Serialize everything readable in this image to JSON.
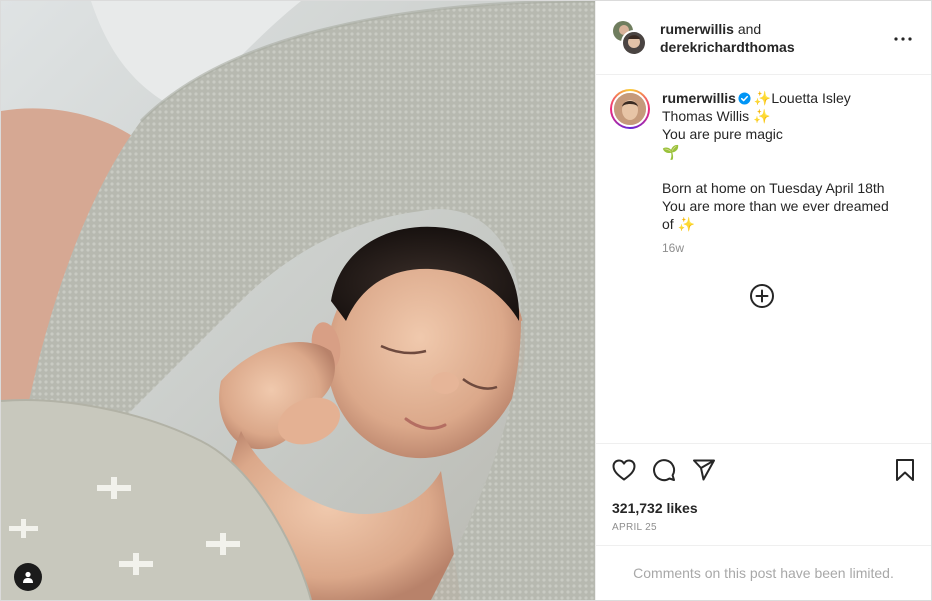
{
  "header": {
    "user1": "rumerwillis",
    "and": "and",
    "user2": "derekrichardthomas"
  },
  "caption": {
    "username": "rumerwillis",
    "lines": [
      "✨Louetta Isley",
      "Thomas Willis ✨",
      "You are pure magic",
      "🌱",
      "",
      "Born at home on Tuesday April 18th",
      "You are more than we ever dreamed",
      "of ✨"
    ],
    "age": "16w"
  },
  "stats": {
    "likes": "321,732 likes",
    "date": "APRIL 25"
  },
  "comments_notice": "Comments on this post have been limited.",
  "icons": {
    "more": "more-horizontal-icon",
    "verified": "verified-badge-icon",
    "plus": "plus-circle-icon",
    "like": "heart-icon",
    "comment": "comment-icon",
    "share": "paper-plane-icon",
    "save": "bookmark-icon",
    "tag": "user-tag-icon"
  },
  "colors": {
    "verified_blue": "#0095f6",
    "text": "#262626",
    "muted": "#8e8e8e"
  }
}
